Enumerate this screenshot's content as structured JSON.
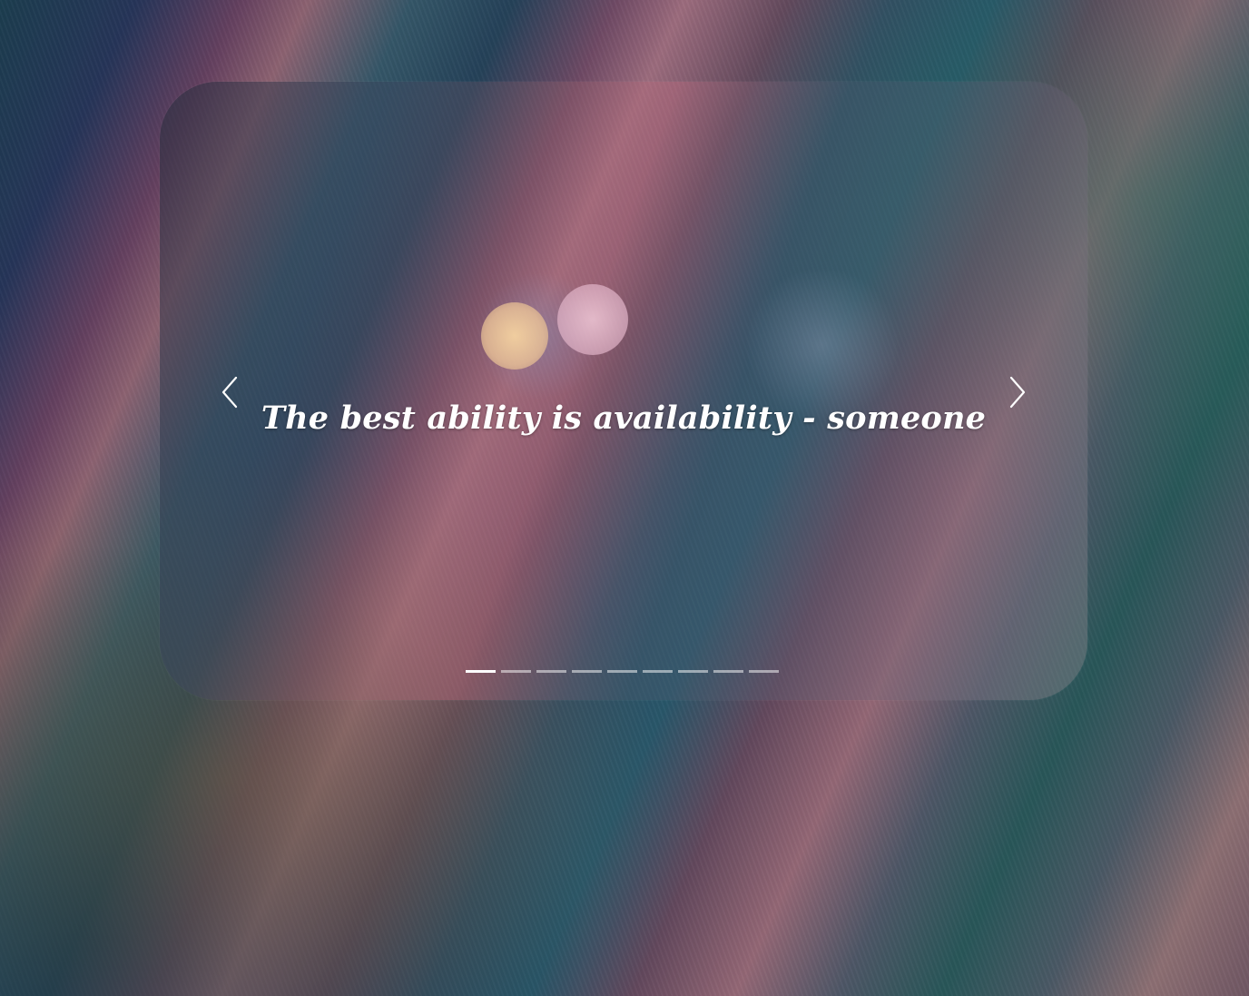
{
  "carousel": {
    "quote": "The best ability is availability - someone",
    "controls": {
      "prev_icon": "chevron-left-icon",
      "next_icon": "chevron-right-icon"
    },
    "indicators": {
      "count": 9,
      "active_index": 0
    }
  },
  "colors": {
    "text": "#ffffff",
    "indicator_active": "#ffffff",
    "indicator_inactive": "rgba(255,255,255,0.5)"
  }
}
